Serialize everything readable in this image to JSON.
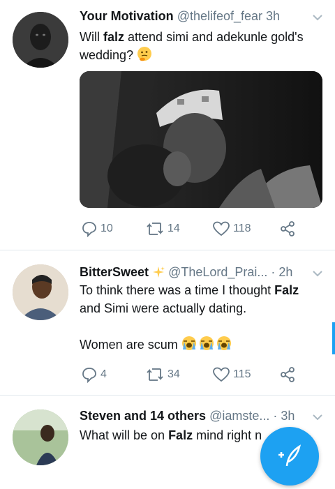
{
  "tweets": [
    {
      "name": "Your Motivation",
      "handle": "@thelifeof_fear",
      "time": "3h",
      "text_pre": "Will ",
      "text_bold": "falz",
      "text_post": " attend simi and adekunle gold's wedding?",
      "emoji": "thinking-face",
      "replies": "10",
      "retweets": "14",
      "likes": "118"
    },
    {
      "name": "BitterSweet",
      "handle": "@TheLord_Prai...",
      "time": "· 2h",
      "line1_pre": "To think there was a time I thought ",
      "line1_bold": "Falz",
      "line2": "and Simi were actually dating.",
      "line3": "Women are scum",
      "emoji": "loudly-crying-face",
      "replies": "4",
      "retweets": "34",
      "likes": "115"
    },
    {
      "name": "Steven and 14 others",
      "handle": "@iamste...",
      "time": "· 3h",
      "text_pre": "What will be on ",
      "text_bold": "Falz",
      "text_post": " mind right n"
    }
  ],
  "colors": {
    "accent": "#1da1f2",
    "text": "#14171a",
    "secondary": "#657786",
    "divider": "#e1e8ed"
  },
  "icons": [
    "reply-icon",
    "retweet-icon",
    "like-icon",
    "share-icon",
    "chevron-down-icon",
    "sparkle-icon",
    "compose-icon"
  ]
}
